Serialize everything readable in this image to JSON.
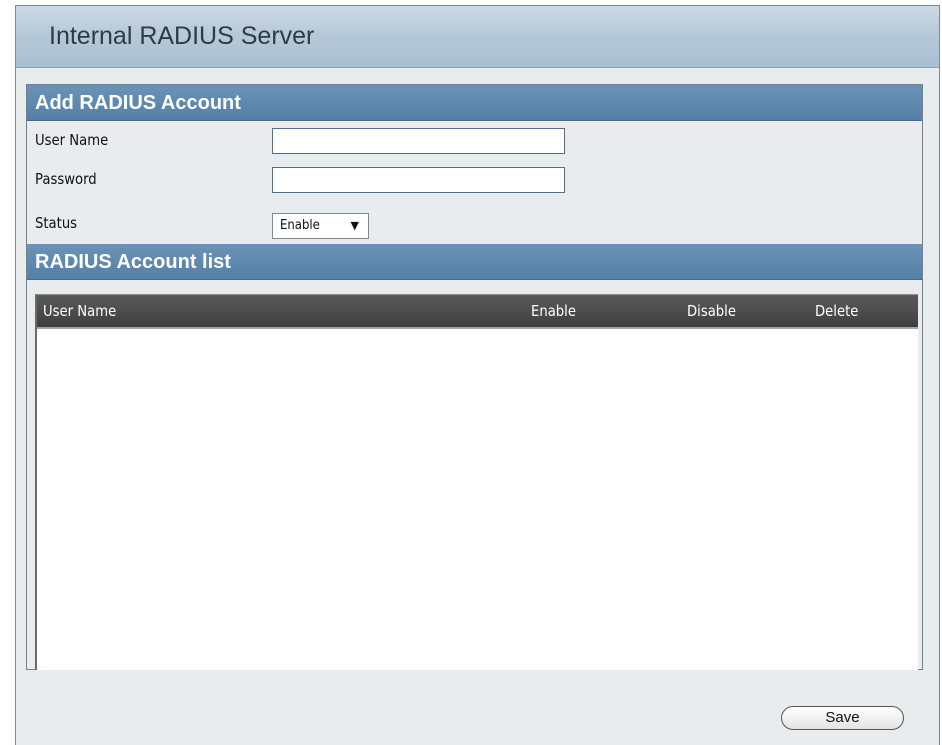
{
  "page": {
    "title": "Internal RADIUS Server"
  },
  "add_account": {
    "header": "Add RADIUS Account",
    "fields": [
      {
        "label": "User Name",
        "value": ""
      },
      {
        "label": "Password",
        "value": ""
      }
    ],
    "status": {
      "label": "Status",
      "selected": "Enable",
      "caret_icon": "▼"
    }
  },
  "account_list": {
    "header": "RADIUS Account list",
    "columns": [
      "User Name",
      "Enable",
      "Disable",
      "Delete"
    ],
    "rows": []
  },
  "actions": {
    "save_label": "Save"
  },
  "colors": {
    "section_header": "#5f89ae",
    "table_header": "#4a4a4a",
    "panel_bg": "#e8eced"
  }
}
